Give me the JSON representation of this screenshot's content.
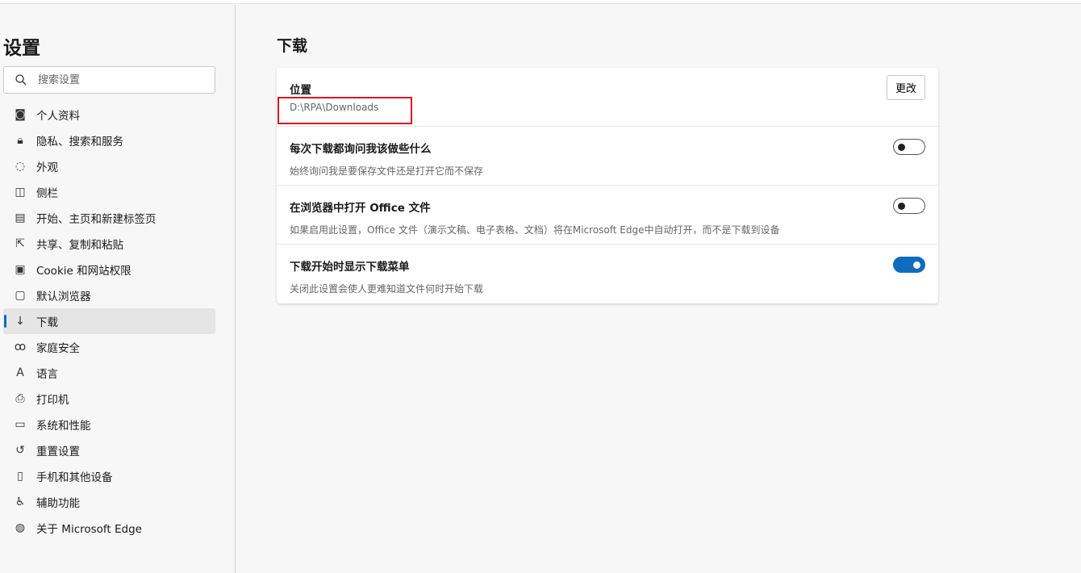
{
  "sidebar": {
    "title": "设置",
    "search_placeholder": "搜索设置",
    "items": [
      {
        "label": "个人资料",
        "icon": "profile-icon"
      },
      {
        "label": "隐私、搜索和服务",
        "icon": "lock-icon"
      },
      {
        "label": "外观",
        "icon": "palette-icon"
      },
      {
        "label": "侧栏",
        "icon": "sidebar-icon"
      },
      {
        "label": "开始、主页和新建标签页",
        "icon": "home-icon"
      },
      {
        "label": "共享、复制和粘贴",
        "icon": "share-icon"
      },
      {
        "label": "Cookie 和网站权限",
        "icon": "cookie-icon"
      },
      {
        "label": "默认浏览器",
        "icon": "browser-icon"
      },
      {
        "label": "下载",
        "icon": "download-icon"
      },
      {
        "label": "家庭安全",
        "icon": "family-icon"
      },
      {
        "label": "语言",
        "icon": "language-icon"
      },
      {
        "label": "打印机",
        "icon": "printer-icon"
      },
      {
        "label": "系统和性能",
        "icon": "laptop-icon"
      },
      {
        "label": "重置设置",
        "icon": "reset-icon"
      },
      {
        "label": "手机和其他设备",
        "icon": "phone-icon"
      },
      {
        "label": "辅助功能",
        "icon": "accessibility-icon"
      },
      {
        "label": "关于 Microsoft Edge",
        "icon": "edge-icon"
      }
    ],
    "active_index": 8
  },
  "main": {
    "title": "下载",
    "location": {
      "label": "位置",
      "path": "D:\\RPA\\Downloads",
      "button": "更改"
    },
    "settings": [
      {
        "title": "每次下载都询问我该做些什么",
        "desc": "始终询问我是要保存文件还是打开它而不保存",
        "on": false
      },
      {
        "title": "在浏览器中打开 Office 文件",
        "desc": "如果启用此设置，Office 文件（演示文稿、电子表格、文档）将在Microsoft Edge中自动打开，而不是下载到设备",
        "on": false
      },
      {
        "title": "下载开始时显示下载菜单",
        "desc": "关闭此设置会使人更难知道文件何时开始下载",
        "on": true
      }
    ]
  },
  "colors": {
    "accent": "#0f6cbd",
    "highlight": "#e0141e"
  }
}
